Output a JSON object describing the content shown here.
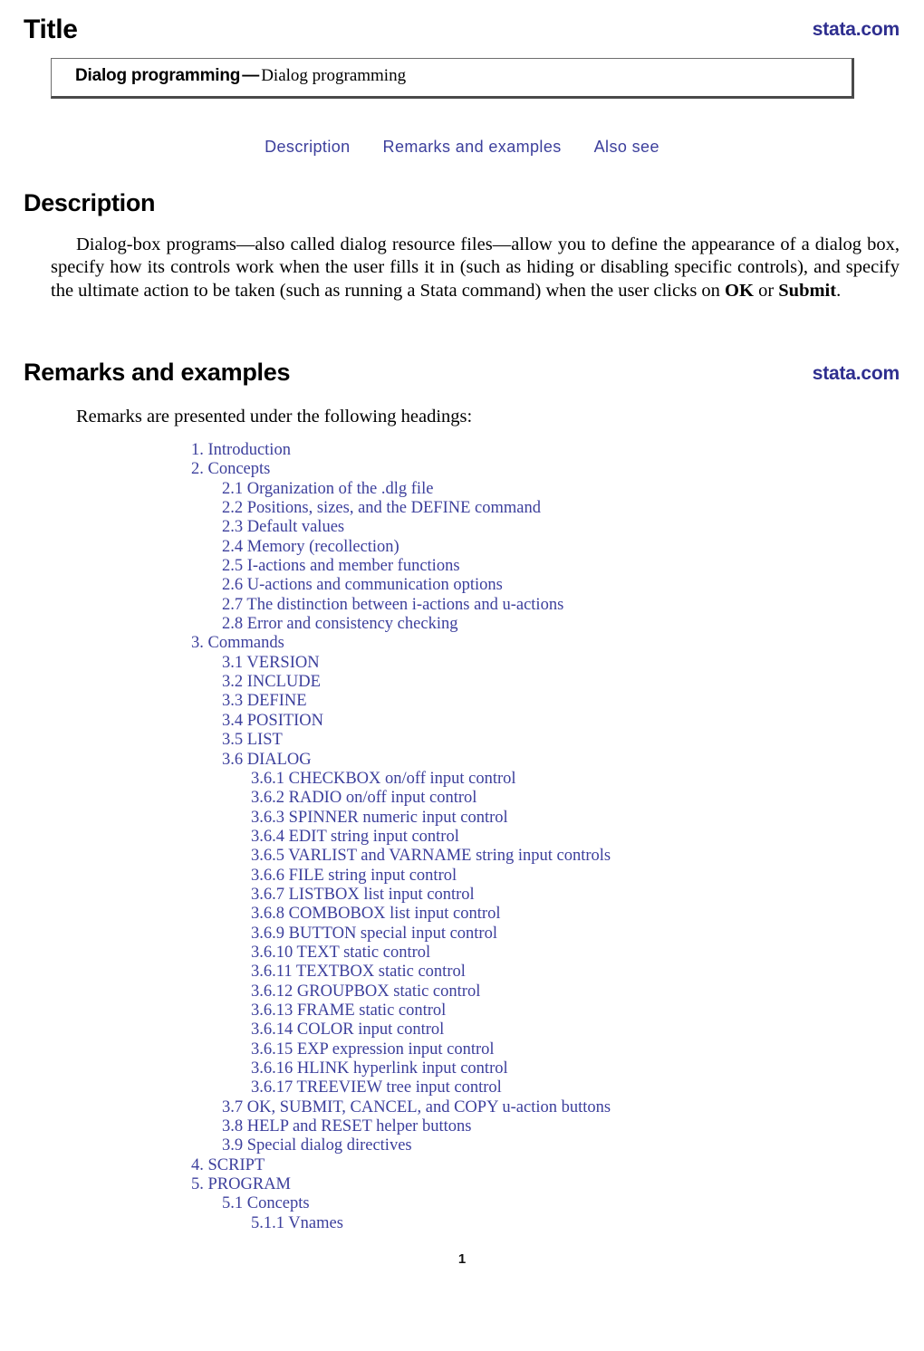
{
  "header": {
    "title": "Title",
    "stata_link": "stata.com"
  },
  "title_box": {
    "entry_name": "Dialog programming",
    "dash": "—",
    "entry_description": "Dialog programming"
  },
  "nav": {
    "links": [
      {
        "label": "Description"
      },
      {
        "label": "Remarks and examples"
      },
      {
        "label": "Also see"
      }
    ]
  },
  "sections": {
    "description": {
      "heading": "Description",
      "paragraph_part1": "Dialog-box programs—also called dialog resource files—allow you to define the appearance of a dialog box, specify how its controls work when the user fills it in (such as hiding or disabling specific controls), and specify the ultimate action to be taken (such as running a Stata command) when the user clicks on ",
      "bold_ok": "OK",
      "paragraph_part2": " or ",
      "bold_submit": "Submit",
      "paragraph_part3": "."
    },
    "remarks": {
      "heading": "Remarks and examples",
      "stata_link": "stata.com",
      "intro": "Remarks are presented under the following headings:"
    }
  },
  "toc": [
    {
      "level": 1,
      "label": "1. Introduction"
    },
    {
      "level": 1,
      "label": "2. Concepts"
    },
    {
      "level": 2,
      "label": "2.1 Organization of the .dlg file"
    },
    {
      "level": 2,
      "label": "2.2 Positions, sizes, and the DEFINE command"
    },
    {
      "level": 2,
      "label": "2.3 Default values"
    },
    {
      "level": 2,
      "label": "2.4 Memory (recollection)"
    },
    {
      "level": 2,
      "label": "2.5 I-actions and member functions"
    },
    {
      "level": 2,
      "label": "2.6 U-actions and communication options"
    },
    {
      "level": 2,
      "label": "2.7 The distinction between i-actions and u-actions"
    },
    {
      "level": 2,
      "label": "2.8 Error and consistency checking"
    },
    {
      "level": 1,
      "label": "3. Commands"
    },
    {
      "level": 2,
      "label": "3.1 VERSION"
    },
    {
      "level": 2,
      "label": "3.2 INCLUDE"
    },
    {
      "level": 2,
      "label": "3.3 DEFINE"
    },
    {
      "level": 2,
      "label": "3.4 POSITION"
    },
    {
      "level": 2,
      "label": "3.5 LIST"
    },
    {
      "level": 2,
      "label": "3.6 DIALOG"
    },
    {
      "level": 3,
      "label": "3.6.1 CHECKBOX on/off input control"
    },
    {
      "level": 3,
      "label": "3.6.2 RADIO on/off input control"
    },
    {
      "level": 3,
      "label": "3.6.3 SPINNER numeric input control"
    },
    {
      "level": 3,
      "label": "3.6.4 EDIT string input control"
    },
    {
      "level": 3,
      "label": "3.6.5 VARLIST and VARNAME string input controls"
    },
    {
      "level": 3,
      "label": "3.6.6 FILE string input control"
    },
    {
      "level": 3,
      "label": "3.6.7 LISTBOX list input control"
    },
    {
      "level": 3,
      "label": "3.6.8 COMBOBOX list input control"
    },
    {
      "level": 3,
      "label": "3.6.9 BUTTON special input control"
    },
    {
      "level": 3,
      "label": "3.6.10 TEXT static control"
    },
    {
      "level": 3,
      "label": "3.6.11 TEXTBOX static control"
    },
    {
      "level": 3,
      "label": "3.6.12 GROUPBOX static control"
    },
    {
      "level": 3,
      "label": "3.6.13 FRAME static control"
    },
    {
      "level": 3,
      "label": "3.6.14 COLOR input control"
    },
    {
      "level": 3,
      "label": "3.6.15 EXP expression input control"
    },
    {
      "level": 3,
      "label": "3.6.16 HLINK hyperlink input control"
    },
    {
      "level": 3,
      "label": "3.6.17 TREEVIEW tree input control"
    },
    {
      "level": 2,
      "label": "3.7 OK, SUBMIT, CANCEL, and COPY u-action buttons"
    },
    {
      "level": 2,
      "label": "3.8 HELP and RESET helper buttons"
    },
    {
      "level": 2,
      "label": "3.9 Special dialog directives"
    },
    {
      "level": 1,
      "label": "4. SCRIPT"
    },
    {
      "level": 1,
      "label": "5. PROGRAM"
    },
    {
      "level": 2,
      "label": "5.1 Concepts"
    },
    {
      "level": 3,
      "label": "5.1.1 Vnames"
    }
  ],
  "footer": {
    "page_number": "1"
  },
  "colors": {
    "link_blue": "#3c3f9c",
    "stata_blue": "#2e2e8f",
    "text_black": "#000000",
    "box_border": "#6e6e6e",
    "box_shadow": "#4a4a4a"
  }
}
